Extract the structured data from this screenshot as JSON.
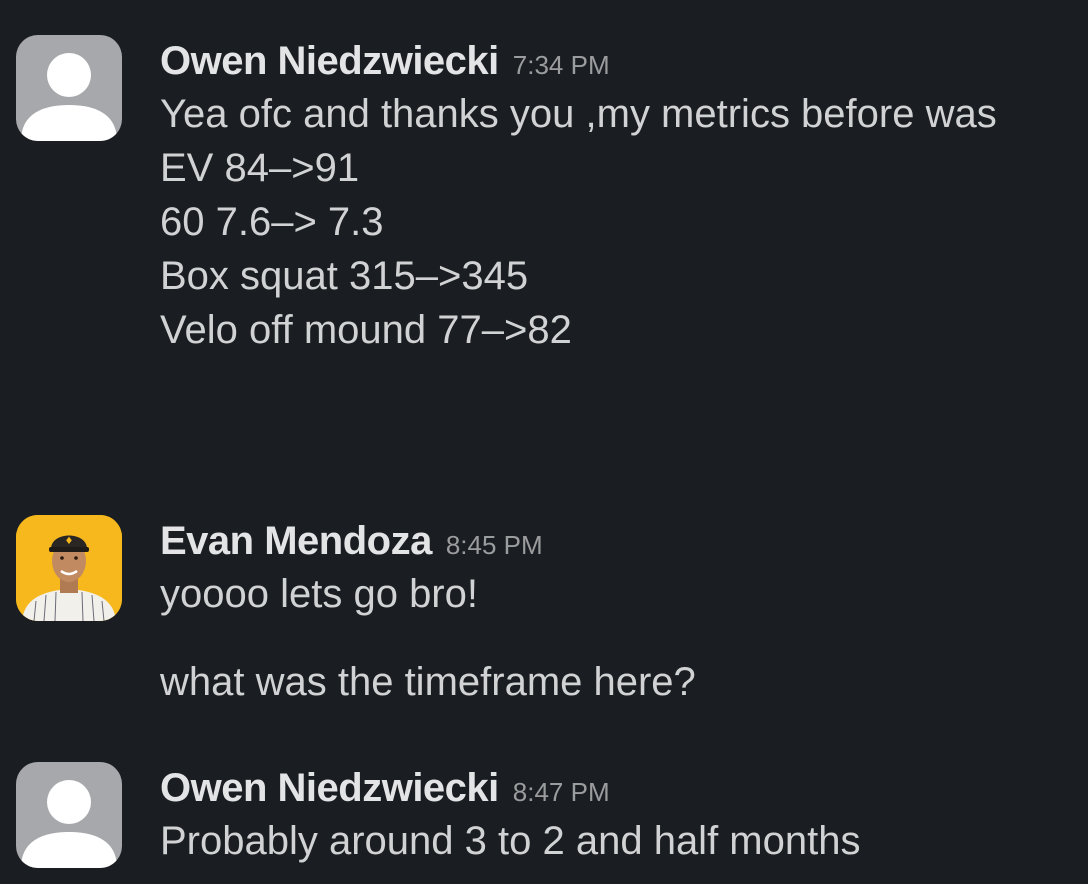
{
  "messages": [
    {
      "author": "Owen Niedzwiecki",
      "time": "7:34 PM",
      "lines": [
        "Yea ofc and thanks you ,my metrics before was",
        "EV 84–>91",
        "60 7.6–> 7.3",
        "Box squat 315–>345",
        "Velo off mound 77–>82"
      ]
    },
    {
      "author": "Evan Mendoza",
      "time": "8:45 PM",
      "lines": [
        "yoooo lets go bro!",
        "what was the timeframe here?"
      ]
    },
    {
      "author": "Owen Niedzwiecki",
      "time": "8:47 PM",
      "lines": [
        "Probably around 3 to 2 and half months"
      ]
    }
  ],
  "avatars": {
    "default": "default-user-avatar-icon",
    "photo": "profile-photo"
  },
  "colors": {
    "background": "#1a1d21",
    "name": "#e3e4e5",
    "text": "#d1d2d3",
    "timestamp": "#9b9c9e",
    "default_avatar": "#a6a8ab",
    "photo_avatar_bg": "#f6b81c"
  }
}
